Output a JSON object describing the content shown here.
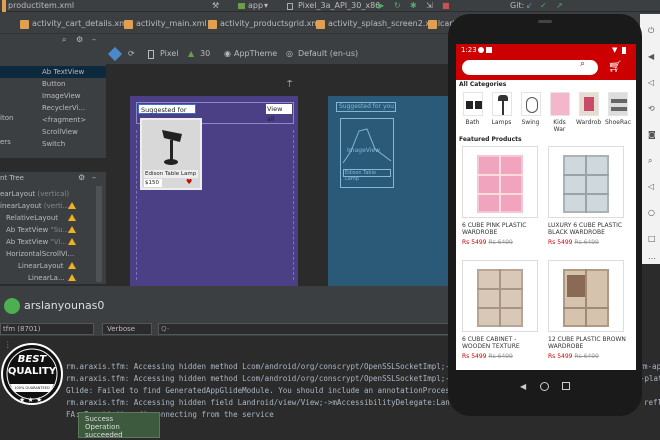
{
  "ide": {
    "file_breadcrumb": "productitem.xml",
    "run_config": "app",
    "device": "Pixel_3a_API_30_x86",
    "git_label": "Git:",
    "tabs": [
      "activity_cart_details.xml",
      "activity_main.xml",
      "activity_productsgrid.xml",
      "activity_splash_screen2.xml",
      "cart"
    ],
    "design_toolbar": {
      "device": "Pixel",
      "api": "30",
      "theme": "AppTheme",
      "locale": "Default (en-us)"
    },
    "palette": [
      {
        "label": "Ab TextView",
        "selected": true
      },
      {
        "label": "Button",
        "selected": false
      },
      {
        "label": "ImageView",
        "selected": false
      },
      {
        "label": "RecyclerVi...",
        "selected": false
      },
      {
        "label": "<fragment>",
        "selected": false
      },
      {
        "label": "ScrollView",
        "selected": false
      },
      {
        "label": "Switch",
        "selected": false
      }
    ],
    "palette_left_fragments": [
      "iton",
      "ers"
    ],
    "component_tree_title": "nt Tree",
    "component_tree": [
      {
        "label": "earLayout",
        "suffix": "(vertical)",
        "warn": false
      },
      {
        "label": "inearLayout",
        "suffix": "(verti...",
        "warn": true
      },
      {
        "label": "RelativeLayout",
        "suffix": "",
        "warn": true
      },
      {
        "label": "Ab TextView",
        "suffix": "\"Su...",
        "warn": true
      },
      {
        "label": "Ab TextView",
        "suffix": "\"Vi...",
        "warn": true
      },
      {
        "label": "HorizontalScrollVi...",
        "suffix": "",
        "warn": false
      },
      {
        "label": "LinearLayout",
        "suffix": "",
        "warn": true
      },
      {
        "label": "LinearLa...",
        "suffix": "",
        "warn": true
      }
    ],
    "preview": {
      "suggested": "Suggested for you",
      "view_all": "View all",
      "item_name": "Edison Table Lamp",
      "item_price": "$150",
      "blueprint_suggested": "Suggested for you",
      "blueprint_image": "ImageView",
      "blueprint_item": "Edison Table Lamp"
    },
    "profile_name": "arslanyounas0",
    "logcat": {
      "process": "tfm (8701)",
      "level": "Verbose",
      "search_placeholder": "Q-",
      "lines": [
        "rm.araxis.tfm: Accessing hidden method Lcom/android/org/conscrypt/OpenSSLSocketImpl;->setA",
        "rm.araxis.tfm: Accessing hidden method Lcom/android/org/conscrypt/OpenSSLSocketImpl;->getA",
        "Glide: Failed to find GeneratedAppGlideModule. You should include an annotationProcessor c",
        "rm.araxis.tfm: Accessing hidden field Landroid/view/View;->mAccessibilityDelegate:Landroid",
        "FA: Inactivity, disconnecting from the service"
      ],
      "right_fragments": [
        "orm-ap",
        "-plat",
        "refl"
      ]
    },
    "toast": {
      "title": "Success",
      "message": "Operation succeeded"
    },
    "badge": {
      "line1": "BEST",
      "line2": "QUALITY",
      "line3": "100% GUARANTEED"
    }
  },
  "app": {
    "status_time": "1:23",
    "search_placeholder": "",
    "categories_title": "All Categories",
    "categories": [
      "Bath",
      "Lamps",
      "Swing",
      "Kids War",
      "Wardrob",
      "ShoeRac"
    ],
    "featured_title": "Featured Products",
    "products": [
      {
        "name": "6 CUBE PINK PLASTIC WARDROBE",
        "price": "Rs 5499",
        "old": "Rs 6499"
      },
      {
        "name": "LUXURY 6 CUBE PLASTIC BLACK WARDROBE",
        "price": "Rs 5499",
        "old": "Rs 6499"
      },
      {
        "name": "6 CUBE CABINET - WOODEN TEXTURE",
        "price": "Rs 5499",
        "old": "Rs 6499"
      },
      {
        "name": "12 CUBE PLASTIC BROWN WARDROBE",
        "price": "Rs 5499",
        "old": "Rs 6499"
      }
    ]
  },
  "colors": {
    "app_primary": "#cc0000",
    "ide_panel": "#3c3f41",
    "ide_bg": "#2b2b2b",
    "layout_preview": "#4b3f86",
    "blueprint": "#2a5a78"
  }
}
